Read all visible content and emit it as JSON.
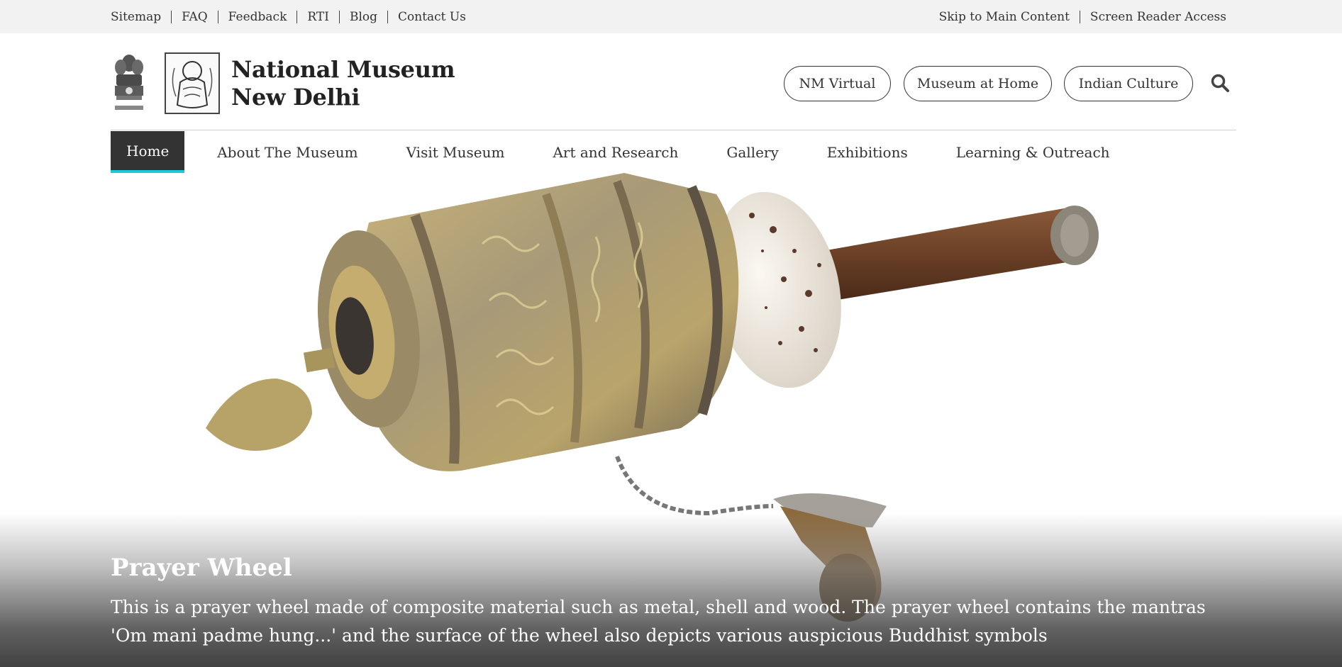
{
  "topbar": {
    "left_links": [
      "Sitemap",
      "FAQ",
      "Feedback",
      "RTI",
      "Blog",
      "Contact Us"
    ],
    "right_links": [
      "Skip to Main Content",
      "Screen Reader Access"
    ]
  },
  "header": {
    "title_line1": "National Museum",
    "title_line2": "New Delhi",
    "emblem_icon": "state-emblem-icon",
    "logo_icon": "museum-logo-icon",
    "buttons": [
      "NM Virtual",
      "Museum at Home",
      "Indian Culture"
    ],
    "search_icon": "search-icon"
  },
  "nav": {
    "items": [
      "Home",
      "About The Museum",
      "Visit Museum",
      "Art and Research",
      "Gallery",
      "Exhibitions",
      "Learning & Outreach"
    ],
    "active": "Home",
    "active_bg": "#333333",
    "active_underline": "#1ec8d8"
  },
  "hero": {
    "title": "Prayer Wheel",
    "description": "This is a prayer wheel made of composite material such as metal, shell and wood. The prayer wheel contains the mantras 'Om mani padme hung...' and the surface of the wheel also depicts various auspicious Buddhist symbols"
  }
}
